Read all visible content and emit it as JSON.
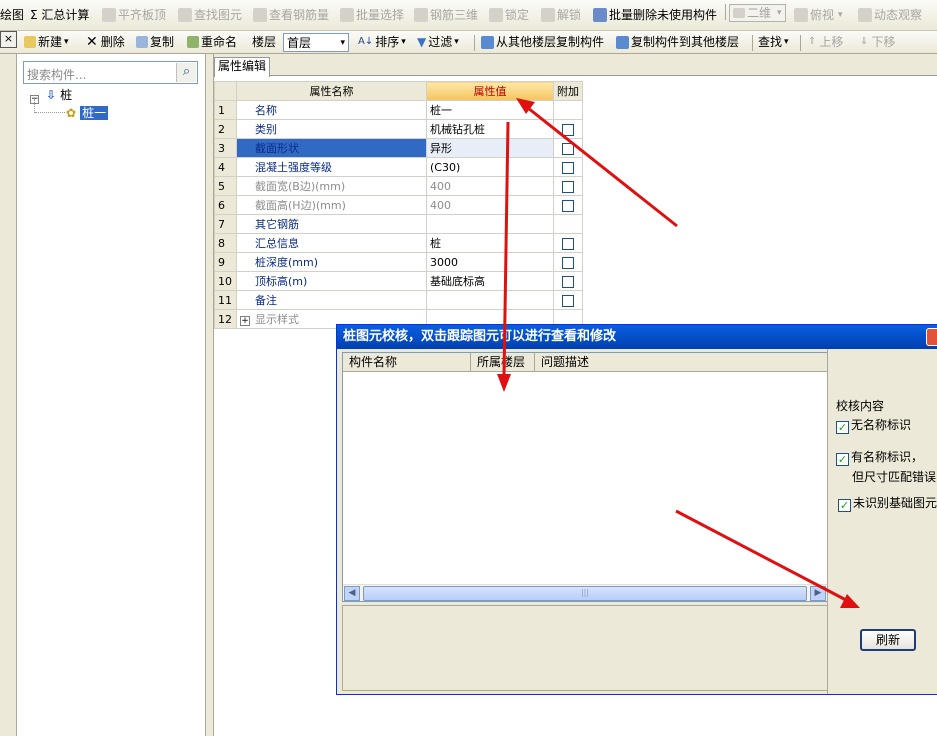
{
  "toolbar1": {
    "items": [
      {
        "label": "绘图",
        "disabled": false
      },
      {
        "label": "Σ 汇总计算",
        "disabled": false
      },
      {
        "label": "平齐板顶",
        "disabled": true
      },
      {
        "label": "查找图元",
        "disabled": true
      },
      {
        "label": "查看钢筋量",
        "disabled": true
      },
      {
        "label": "批量选择",
        "disabled": true
      },
      {
        "label": "钢筋三维",
        "disabled": true
      },
      {
        "label": "锁定",
        "disabled": true
      },
      {
        "label": "解锁",
        "disabled": true
      },
      {
        "label": "批量删除未使用构件",
        "disabled": false
      },
      {
        "label": "二维",
        "disabled": true
      },
      {
        "label": "俯视",
        "disabled": true
      },
      {
        "label": "动态观察",
        "disabled": true
      }
    ]
  },
  "toolbar2": {
    "close": "×",
    "new": "新建",
    "delete": "删除",
    "copy": "复制",
    "rename": "重命名",
    "floor_label": "楼层",
    "floor_value": "首层",
    "sort": "排序",
    "filter": "过滤",
    "copy_from_floor": "从其他楼层复制构件",
    "copy_to_floor": "复制构件到其他楼层",
    "find": "查找",
    "move_up": "上移",
    "move_down": "下移"
  },
  "component_panel": {
    "search_placeholder": "搜索构件...",
    "tree_root": "桩",
    "tree_child": "桩一"
  },
  "property_editor": {
    "tab": "属性编辑",
    "headers": {
      "name": "属性名称",
      "value": "属性值",
      "extra": "附加"
    },
    "rows": [
      {
        "num": "1",
        "name": "名称",
        "value": "桩一",
        "checkbox": false,
        "style": "normal"
      },
      {
        "num": "2",
        "name": "类别",
        "value": "机械钻孔桩",
        "checkbox": true,
        "style": "normal"
      },
      {
        "num": "3",
        "name": "截面形状",
        "value": "异形",
        "checkbox": true,
        "style": "selected"
      },
      {
        "num": "4",
        "name": "混凝土强度等级",
        "value": "(C30)",
        "checkbox": true,
        "style": "normal"
      },
      {
        "num": "5",
        "name": "截面宽(B边)(mm)",
        "value": "400",
        "checkbox": true,
        "style": "gray"
      },
      {
        "num": "6",
        "name": "截面高(H边)(mm)",
        "value": "400",
        "checkbox": true,
        "style": "gray"
      },
      {
        "num": "7",
        "name": "其它钢筋",
        "value": "",
        "checkbox": false,
        "style": "normal"
      },
      {
        "num": "8",
        "name": "汇总信息",
        "value": "桩",
        "checkbox": true,
        "style": "normal"
      },
      {
        "num": "9",
        "name": "桩深度(mm)",
        "value": "3000",
        "checkbox": true,
        "style": "normal"
      },
      {
        "num": "10",
        "name": "顶标高(m)",
        "value": "基础底标高",
        "checkbox": true,
        "style": "normal"
      },
      {
        "num": "11",
        "name": "备注",
        "value": "",
        "checkbox": true,
        "style": "normal"
      },
      {
        "num": "12",
        "name": "显示样式",
        "value": "",
        "checkbox": false,
        "style": "expand"
      }
    ]
  },
  "dialog": {
    "title": "桩图元校核，双击跟踪图元可以进行查看和修改",
    "columns": [
      "构件名称",
      "所属楼层",
      "问题描述"
    ],
    "section_label": "校核内容",
    "options": [
      "无名称标识",
      "有名称标识，",
      "但尺寸匹配错误",
      "未识别基础图元"
    ],
    "refresh": "刷新"
  },
  "colors": {
    "accent": "#316ac5",
    "titlebar": "#0a5fe0",
    "annotation_arrow": "#e01010"
  }
}
